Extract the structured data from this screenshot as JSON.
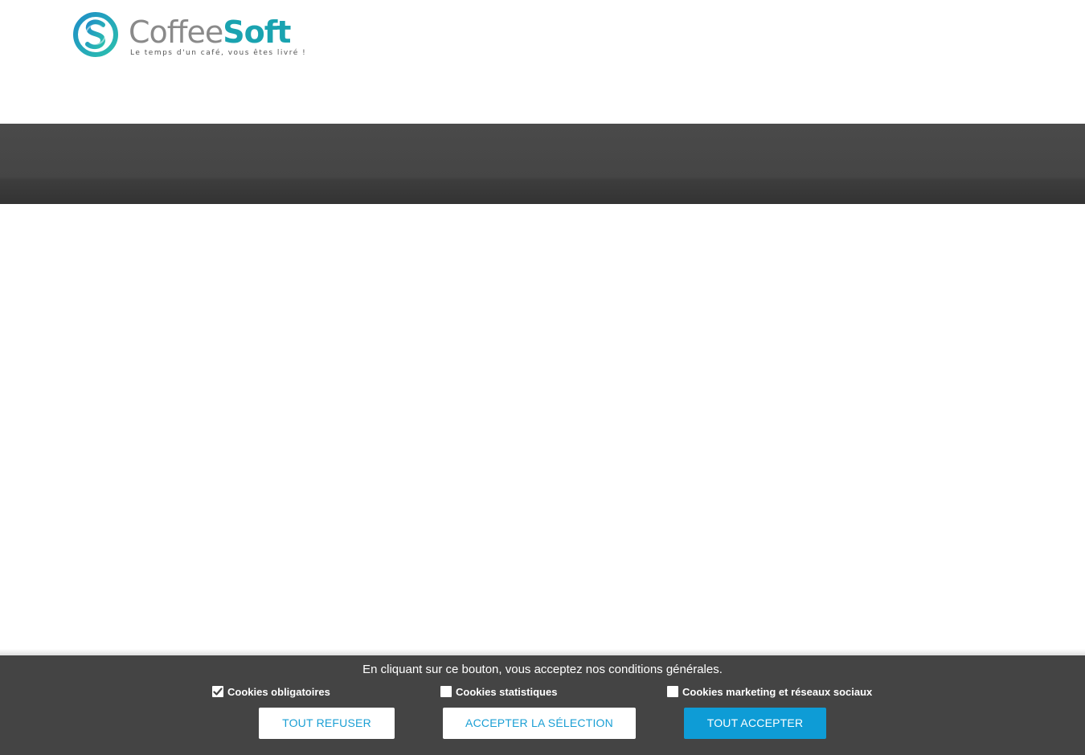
{
  "header": {
    "logo": {
      "word_part1": "Coffee",
      "word_part2": "Soft",
      "tagline": "Le temps d'un café, vous êtes livré !",
      "colors": {
        "gray": "#8a8a8a",
        "teal": "#1aa3b0",
        "blue": "#1f8fc7"
      }
    }
  },
  "navband": {
    "color": "#444444"
  },
  "cookie_banner": {
    "message": "En cliquant sur ce bouton, vous acceptez nos conditions générales.",
    "options": [
      {
        "label": "Cookies obligatoires",
        "checked": true
      },
      {
        "label": "Cookies statistiques",
        "checked": false
      },
      {
        "label": "Cookies marketing et réseaux sociaux",
        "checked": false
      }
    ],
    "buttons": {
      "refuse_all": "TOUT REFUSER",
      "accept_selection": "ACCEPTER LA SÉLECTION",
      "accept_all": "TOUT ACCEPTER"
    },
    "colors": {
      "background": "#444444",
      "accent": "#0e9cd6"
    }
  }
}
